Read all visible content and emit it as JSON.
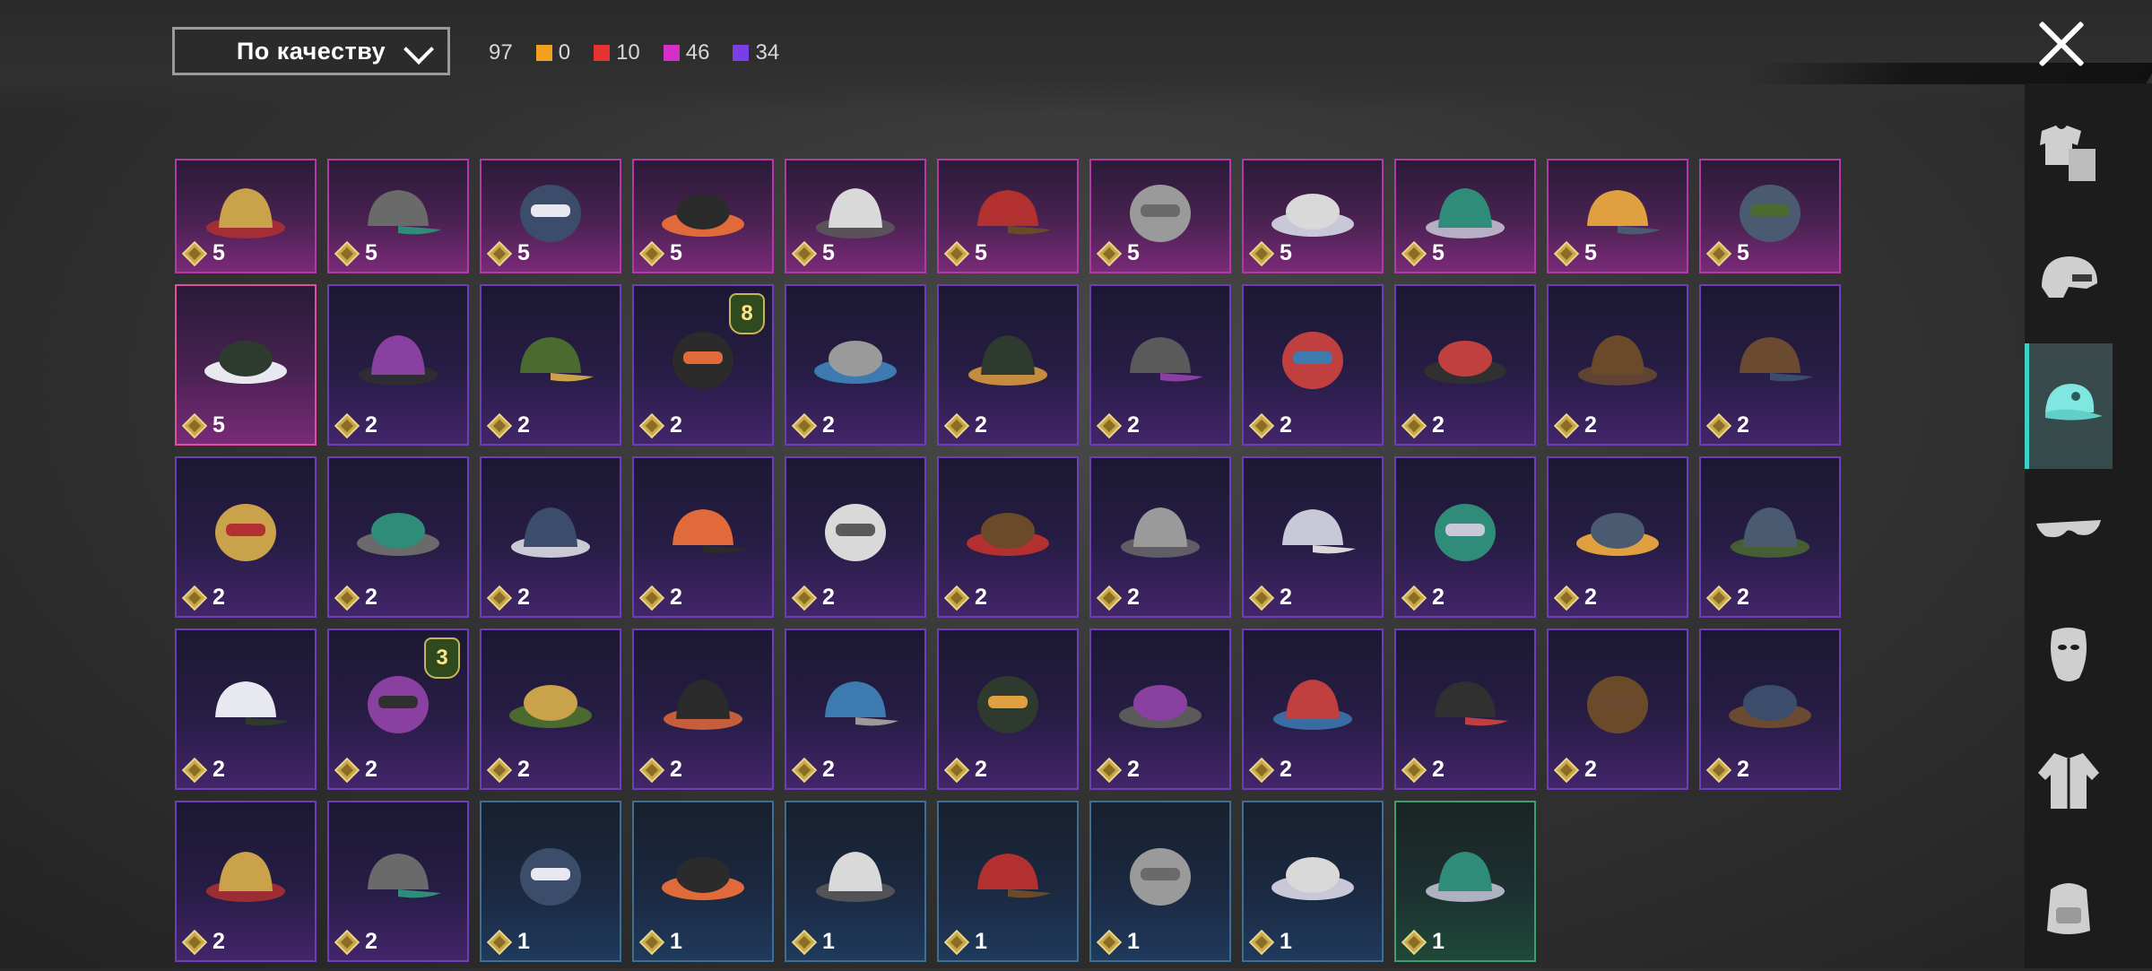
{
  "header": {
    "sort_label": "По качеству",
    "total_count": "97",
    "rarity_counts": [
      {
        "color": "#f2a01e",
        "value": "0"
      },
      {
        "color": "#e53232",
        "value": "10"
      },
      {
        "color": "#d430c8",
        "value": "46"
      },
      {
        "color": "#7a3de6",
        "value": "34"
      }
    ]
  },
  "items": [
    {
      "icon": "helmet-gold-icon",
      "count": "5",
      "quality": "pink"
    },
    {
      "icon": "horned-helmet-icon",
      "count": "5",
      "quality": "pink"
    },
    {
      "icon": "knight-helmet-icon",
      "count": "5",
      "quality": "pink"
    },
    {
      "icon": "antler-hat-icon",
      "count": "5",
      "quality": "pink"
    },
    {
      "icon": "santa-hat-icon",
      "count": "5",
      "quality": "pink"
    },
    {
      "icon": "tribal-mask-icon",
      "count": "5",
      "quality": "pink"
    },
    {
      "icon": "bucket-helmet-icon",
      "count": "5",
      "quality": "pink"
    },
    {
      "icon": "headphone-helmet-icon",
      "count": "5",
      "quality": "pink"
    },
    {
      "icon": "jellyfish-hat-icon",
      "count": "5",
      "quality": "pink"
    },
    {
      "icon": "frog-goggles-hat-icon",
      "count": "5",
      "quality": "pink"
    },
    {
      "icon": "gas-mask-helmet-icon",
      "count": "5",
      "quality": "pink"
    },
    {
      "icon": "white-bucket-hat-icon",
      "count": "5",
      "quality": "pink",
      "selected": true
    },
    {
      "icon": "devil-horns-icon",
      "count": "2",
      "quality": "purple"
    },
    {
      "icon": "officer-cap-icon",
      "count": "2",
      "quality": "purple"
    },
    {
      "icon": "skull-hood-icon",
      "count": "2",
      "quality": "purple",
      "level": "8"
    },
    {
      "icon": "baseball-cap-icon",
      "count": "2",
      "quality": "purple"
    },
    {
      "icon": "gas-mask-icon",
      "count": "2",
      "quality": "purple"
    },
    {
      "icon": "witch-hat-icon",
      "count": "2",
      "quality": "purple"
    },
    {
      "icon": "racing-helmet-icon",
      "count": "2",
      "quality": "purple"
    },
    {
      "icon": "green-cap-icon",
      "count": "2",
      "quality": "purple"
    },
    {
      "icon": "steampunk-hat-icon",
      "count": "2",
      "quality": "purple"
    },
    {
      "icon": "brown-wig-icon",
      "count": "2",
      "quality": "purple"
    },
    {
      "icon": "black-gas-mask-icon",
      "count": "2",
      "quality": "purple"
    },
    {
      "icon": "goggles-beanie-icon",
      "count": "2",
      "quality": "purple"
    },
    {
      "icon": "knit-hat-icon",
      "count": "2",
      "quality": "purple"
    },
    {
      "icon": "oni-mask-icon",
      "count": "2",
      "quality": "purple"
    },
    {
      "icon": "bunny-ears-icon",
      "count": "2",
      "quality": "purple"
    },
    {
      "icon": "black-cap-icon",
      "count": "2",
      "quality": "purple"
    },
    {
      "icon": "shark-hat-icon",
      "count": "2",
      "quality": "purple"
    },
    {
      "icon": "red-beret-icon",
      "count": "2",
      "quality": "purple"
    },
    {
      "icon": "top-hat-icon",
      "count": "2",
      "quality": "purple"
    },
    {
      "icon": "red-fedora-icon",
      "count": "2",
      "quality": "purple"
    },
    {
      "icon": "flower-crown-icon",
      "count": "2",
      "quality": "purple"
    },
    {
      "icon": "red-bucket-hat-icon",
      "count": "2",
      "quality": "purple"
    },
    {
      "icon": "daisy-crown-icon",
      "count": "2",
      "quality": "purple",
      "level": "3"
    },
    {
      "icon": "cake-hat-icon",
      "count": "2",
      "quality": "purple"
    },
    {
      "icon": "burger-hat-icon",
      "count": "2",
      "quality": "purple"
    },
    {
      "icon": "black-beanie-icon",
      "count": "2",
      "quality": "purple"
    },
    {
      "icon": "head-mirror-icon",
      "count": "2",
      "quality": "purple"
    },
    {
      "icon": "sailor-cap-icon",
      "count": "2",
      "quality": "purple"
    },
    {
      "icon": "brown-fedora-icon",
      "count": "2",
      "quality": "purple"
    },
    {
      "icon": "peaked-cap-icon",
      "count": "2",
      "quality": "purple"
    },
    {
      "icon": "bandana-icon",
      "count": "2",
      "quality": "purple"
    },
    {
      "icon": "black-bucket-hat-icon",
      "count": "2",
      "quality": "purple"
    },
    {
      "icon": "aviator-cap-icon",
      "count": "2",
      "quality": "purple"
    },
    {
      "icon": "red-military-beret-icon",
      "count": "2",
      "quality": "purple"
    },
    {
      "icon": "blue-beret-icon",
      "count": "1",
      "quality": "blue"
    },
    {
      "icon": "grey-beret-icon",
      "count": "1",
      "quality": "blue"
    },
    {
      "icon": "red-baseball-cap-icon",
      "count": "1",
      "quality": "blue"
    },
    {
      "icon": "blue-baseball-cap-icon",
      "count": "1",
      "quality": "blue"
    },
    {
      "icon": "navy-beret-icon",
      "count": "1",
      "quality": "blue"
    },
    {
      "icon": "camo-cap-headset-icon",
      "count": "1",
      "quality": "blue"
    },
    {
      "icon": "patrol-cap-icon",
      "count": "1",
      "quality": "green"
    }
  ],
  "side_tabs": [
    {
      "icon": "outfit-icon",
      "active": false
    },
    {
      "icon": "helmet-icon",
      "active": false
    },
    {
      "icon": "cap-icon",
      "active": true
    },
    {
      "icon": "glasses-icon",
      "active": false
    },
    {
      "icon": "mask-icon",
      "active": false
    },
    {
      "icon": "jacket-icon",
      "active": false
    },
    {
      "icon": "backpack-face-icon",
      "active": false
    }
  ]
}
